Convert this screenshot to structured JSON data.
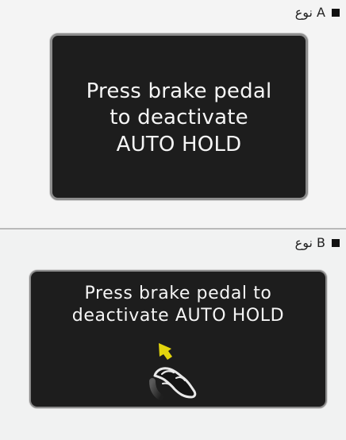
{
  "sections": [
    {
      "type_label": "نوع A",
      "message_lines": [
        "Press brake pedal",
        "to deactivate",
        "AUTO HOLD"
      ]
    },
    {
      "type_label": "نوع B",
      "message_lines": [
        "Press brake pedal to",
        "deactivate AUTO HOLD"
      ],
      "icon": "brake-pedal-icon"
    }
  ],
  "colors": {
    "screen_bg": "#1d1d1d",
    "text": "#f5f5f5",
    "arrow": "#e3d50d"
  }
}
